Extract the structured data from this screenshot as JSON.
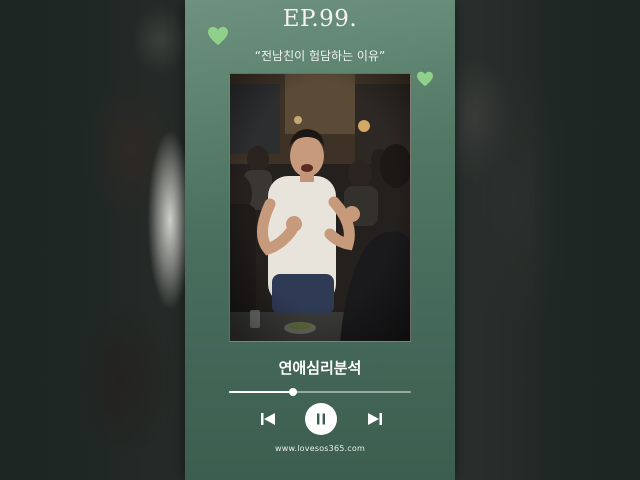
{
  "episode": "EP.99.",
  "subtitle": "“전남친이 험담하는 이유”",
  "program_title": "연애심리분석",
  "website": "www.lovesos365.com",
  "player": {
    "progress": 0.35,
    "state": "playing"
  },
  "colors": {
    "card_top": "#5e8571",
    "card_bottom": "#3c5e4f",
    "heart": "#8fd08a",
    "text": "#ffffff"
  },
  "icons": {
    "heart": "heart-icon",
    "prev": "skip-previous-icon",
    "pause": "pause-icon",
    "next": "skip-next-icon"
  }
}
